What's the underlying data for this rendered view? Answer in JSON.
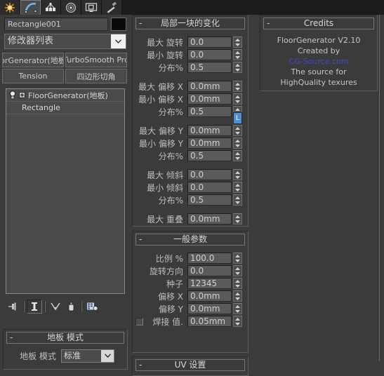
{
  "tabbar": {
    "tabs": [
      {
        "name": "create",
        "icon": "star-create-icon",
        "selected": false
      },
      {
        "name": "modify",
        "icon": "curve-modify-icon",
        "selected": true
      },
      {
        "name": "hierarchy",
        "icon": "hierarchy-icon",
        "selected": false
      },
      {
        "name": "motion",
        "icon": "motion-wheel-icon",
        "selected": false
      },
      {
        "name": "display",
        "icon": "display-monitor-icon",
        "selected": false
      },
      {
        "name": "utilities",
        "icon": "hammer-utilities-icon",
        "selected": false
      }
    ]
  },
  "object": {
    "name_value": "Rectangle001",
    "color_swatch": "#0a0a0a",
    "modifier_list_label": "修改器列表"
  },
  "modifier_buttons": [
    {
      "label": "orGenerator(地板"
    },
    {
      "label": "TurboSmooth Pro"
    },
    {
      "label": "Tension"
    },
    {
      "label": "四边形切角"
    }
  ],
  "stack": {
    "rows": [
      {
        "label": "FloorGenerator(地板)",
        "has_bulb": true,
        "has_plus": true,
        "sub": false
      },
      {
        "label": "Rectangle",
        "has_bulb": false,
        "has_plus": false,
        "sub": true
      }
    ]
  },
  "stack_tools": [
    {
      "name": "pin-stack-icon",
      "pressed": false
    },
    {
      "name": "show-end-result-icon",
      "pressed": true
    },
    {
      "name": "make-unique-icon",
      "pressed": false
    },
    {
      "name": "remove-modifier-icon",
      "pressed": false
    },
    {
      "name": "configure-modifier-sets-icon",
      "pressed": false
    }
  ],
  "floor_mode": {
    "title": "地板 模式",
    "collapse": "-",
    "label": "地板 模式",
    "value": "标准"
  },
  "local_variations": {
    "title": "局部一块的变化",
    "collapse": "-",
    "link_badge": "L",
    "rows": [
      {
        "label": "最大 旋转",
        "value": "0.0"
      },
      {
        "label": "最小 旋转",
        "value": "0.0"
      },
      {
        "label": "分布%",
        "value": "0.5"
      },
      {
        "label": "最大 偏移 X",
        "value": "0.0mm"
      },
      {
        "label": "最小 偏移 X",
        "value": "0.0mm"
      },
      {
        "label": "分布%",
        "value": "0.5"
      },
      {
        "label": "最大 偏移 Y",
        "value": "0.0mm"
      },
      {
        "label": "最小 偏移 Y",
        "value": "0.0mm"
      },
      {
        "label": "分布%",
        "value": "0.5"
      },
      {
        "label": "最大 倾斜",
        "value": "0.0"
      },
      {
        "label": "最小 倾斜",
        "value": "0.0"
      },
      {
        "label": "分布%",
        "value": "0.5"
      },
      {
        "label": "最大 重叠",
        "value": "0.0mm"
      }
    ]
  },
  "general_params": {
    "title": "一般参数",
    "collapse": "-",
    "rows": [
      {
        "label": "比例 %",
        "value": "100.0",
        "checkbox": false
      },
      {
        "label": "旋转方向",
        "value": "0.0",
        "checkbox": false
      },
      {
        "label": "种子",
        "value": "12345",
        "checkbox": false
      },
      {
        "label": "偏移 X",
        "value": "0.0mm",
        "checkbox": false
      },
      {
        "label": "偏移 Y",
        "value": "0.0mm",
        "checkbox": false
      },
      {
        "label": "焊接 值.",
        "value": "0.05mm",
        "checkbox": true
      }
    ]
  },
  "uv_settings": {
    "title": "UV 设置",
    "collapse": "-"
  },
  "credits": {
    "title": "Credits",
    "collapse": "-",
    "lines": [
      {
        "text": "FloorGenerator V2.10",
        "link": false
      },
      {
        "text": "Created by",
        "link": false
      },
      {
        "text": "CG-Source.com",
        "link": true
      },
      {
        "text": "The source for",
        "link": false
      },
      {
        "text": "HighQuality texures",
        "link": false
      }
    ]
  },
  "colors": {
    "panel_bg": "#3b3b3b",
    "field_bg": "#5a5a5a",
    "accent_link": "#4646d2",
    "badge_blue": "#4b8fd4",
    "selected_tab": "#4a4a4a"
  }
}
